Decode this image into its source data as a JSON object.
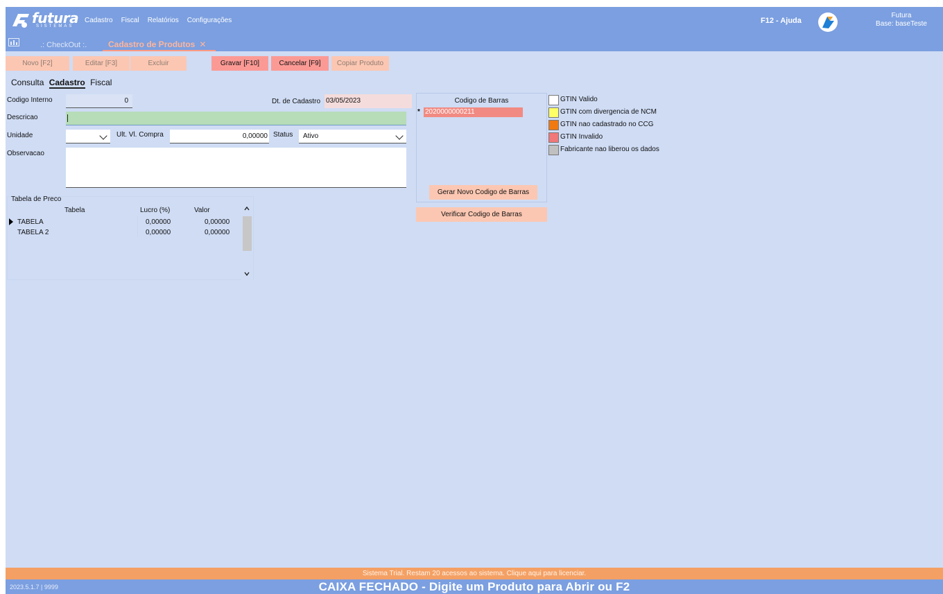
{
  "app": {
    "logo_word": "futura",
    "logo_sub": "SISTEMAS",
    "menu": [
      "Cadastro",
      "Fiscal",
      "Relatórios",
      "Configurações"
    ],
    "help": "F12 - Ajuda",
    "user_name": "Futura",
    "user_base": "Base: baseTeste"
  },
  "tabs": {
    "checkout": ".: CheckOut :.",
    "produtos": "Cadastro de Produtos",
    "close": "✕"
  },
  "toolbar": {
    "novo": "Novo [F2]",
    "editar": "Editar [F3]",
    "excluir": "Excluir",
    "gravar": "Gravar [F10]",
    "cancelar": "Cancelar [F9]",
    "copiar": "Copiar Produto"
  },
  "subtabs": [
    "Consulta",
    "Cadastro",
    "Fiscal"
  ],
  "form": {
    "codigo_label": "Codigo Interno",
    "codigo_value": "0",
    "dt_label": "Dt. de Cadastro",
    "dt_value": "03/05/2023",
    "descricao_label": "Descricao",
    "descricao_value": "",
    "unidade_label": "Unidade",
    "unidade_value": "",
    "ult_label": "Ult. Vl. Compra",
    "ult_value": "0,00000",
    "status_label": "Status",
    "status_value": "Ativo",
    "obs_label": "Observacao",
    "obs_value": ""
  },
  "barcode": {
    "title": "Codigo de Barras",
    "marker": "*",
    "value": "2020000000211",
    "gerar": "Gerar Novo Codigo de Barras",
    "verificar": "Verificar Codigo de Barras"
  },
  "legend": [
    {
      "label": "GTIN Valido",
      "color": "#ffffff"
    },
    {
      "label": "GTIN com divergencia de NCM",
      "color": "#ffff66"
    },
    {
      "label": "GTIN nao cadastrado no CCG",
      "color": "#f07a10"
    },
    {
      "label": "GTIN Invalido",
      "color": "#f07878"
    },
    {
      "label": "Fabricante nao liberou os dados",
      "color": "#c0c0c0"
    }
  ],
  "price_table": {
    "title": "Tabela de Preco",
    "headers": [
      "Tabela",
      "Lucro (%)",
      "Valor"
    ],
    "rows": [
      {
        "tabela": "TABELA",
        "lucro": "0,00000",
        "valor": "0,00000"
      },
      {
        "tabela": "TABELA 2",
        "lucro": "0,00000",
        "valor": "0,00000"
      }
    ]
  },
  "footer": {
    "trial": "Sistema Trial. Restam 20 acessos ao sistema. Clique aqui para licenciar.",
    "version": "2023.5.1.7 | 9999",
    "caixa": "CAIXA FECHADO - Digite um Produto para Abrir ou F2"
  },
  "colors": {
    "header": "#7b9fe0",
    "workspace": "#cfdcf4",
    "button_disabled": "#fcc7b2",
    "button_active": "#fb9a95",
    "trial_bar": "#f4a064",
    "descricao_bg": "#b6dcb8",
    "dt_bg": "#f5dcdc"
  }
}
